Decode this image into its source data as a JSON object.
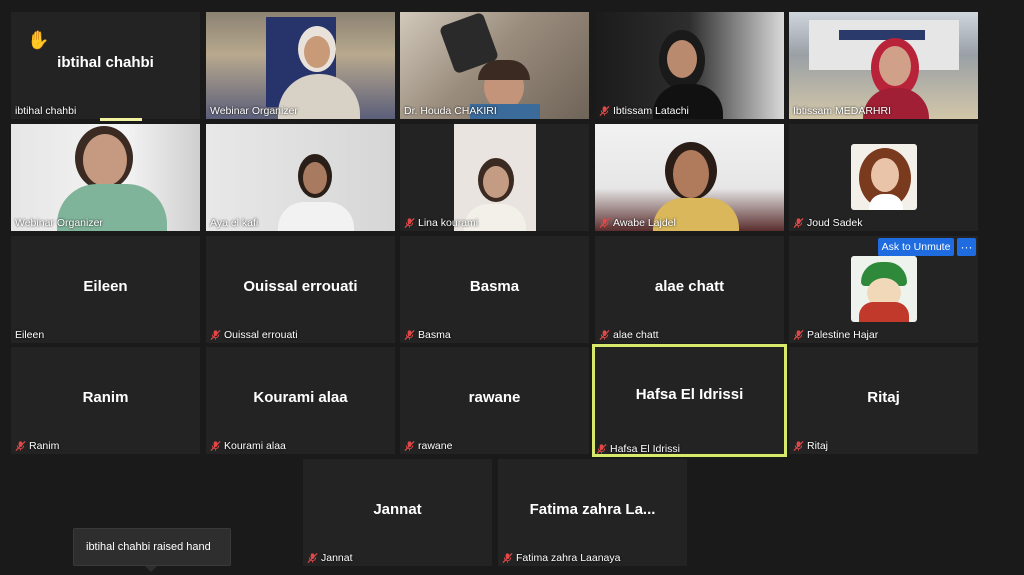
{
  "accent_color": "#1f6be0",
  "active_speaker_color": "#d8e86a",
  "raised_hand_icon": "raised-hand-icon",
  "tiles": [
    {
      "name": "ibtihal chahbi",
      "center": "ibtihal chahbi",
      "muted": false
    },
    {
      "name": "Webinar  Organizer",
      "muted": false
    },
    {
      "name": "Dr. Houda CHAKIRI",
      "muted": false
    },
    {
      "name": "Ibtissam Latachi",
      "muted": true
    },
    {
      "name": "Ibtissam MEDARHRI",
      "muted": false
    },
    {
      "name": "Webinar  Organizer",
      "muted": false
    },
    {
      "name": "Aya el kafi",
      "muted": false
    },
    {
      "name": "Lina kourami",
      "muted": true
    },
    {
      "name": "Awabe Lajdel",
      "muted": true
    },
    {
      "name": "Joud Sadek",
      "muted": true
    },
    {
      "name": "Eileen",
      "center": "Eileen",
      "muted": false
    },
    {
      "name": "Ouissal errouati",
      "center": "Ouissal errouati",
      "muted": true
    },
    {
      "name": "Basma",
      "center": "Basma",
      "muted": true
    },
    {
      "name": "alae chatt",
      "center": "alae chatt",
      "muted": true
    },
    {
      "name": "Palestine Hajar",
      "muted": true
    },
    {
      "name": "Ranim",
      "center": "Ranim",
      "muted": true
    },
    {
      "name": "Kourami alaa",
      "center": "Kourami alaa",
      "muted": true
    },
    {
      "name": "rawane",
      "center": "rawane",
      "muted": true
    },
    {
      "name": "Hafsa El Idrissi",
      "center": "Hafsa El Idrissi",
      "muted": true
    },
    {
      "name": "Ritaj",
      "center": "Ritaj",
      "muted": true
    },
    {
      "name": "Jannat",
      "center": "Jannat",
      "muted": true
    },
    {
      "name": "Fatima zahra Laanaya",
      "center": "Fatima  zahra  La...",
      "muted": true
    }
  ],
  "controls": {
    "ask_to_unmute": "Ask to Unmute",
    "more": "···"
  },
  "notification": "ibtihal chahbi raised hand"
}
